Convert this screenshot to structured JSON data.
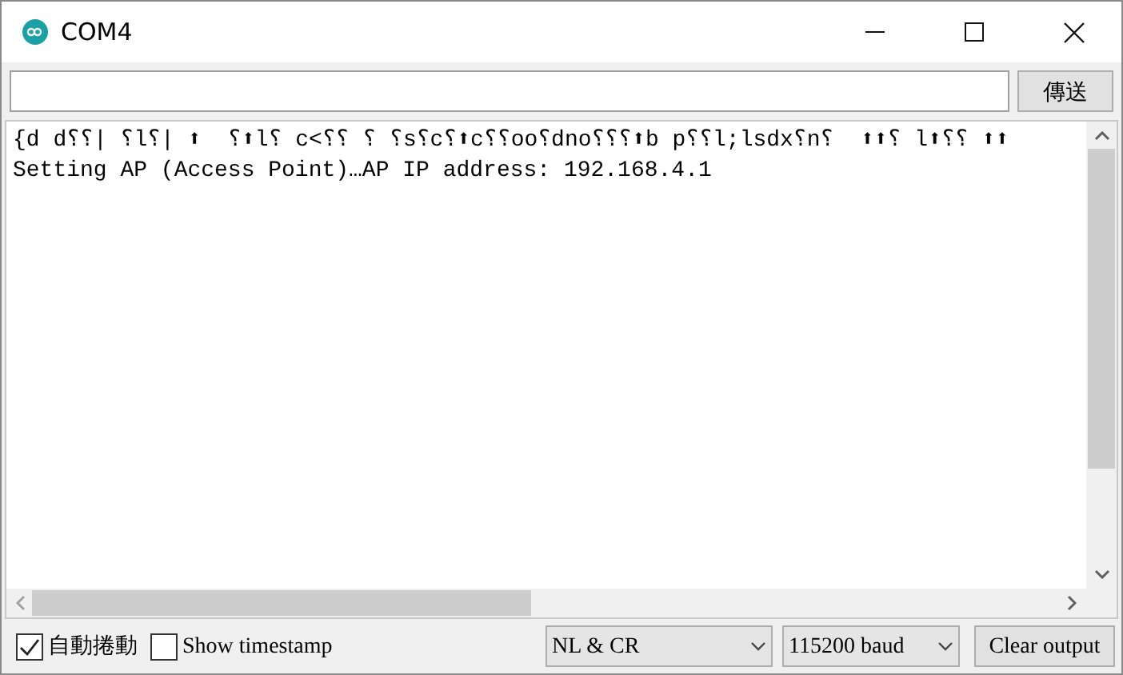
{
  "window": {
    "title": "COM4"
  },
  "send_bar": {
    "send_button": "傳送"
  },
  "output": {
    "lines": [
      "{d d⸮⸮| ⸮l⸮| ⬆  ⸮⬆l⸮ c<⸮⸮ ⸮ ⸮s⸮c⸮⬆c⸮⸮oo⸮dno⸮⸮⸮⬆b p⸮⸮l;lsdx⸮n⸮  ⬆⬆⸮ l⬆⸮⸮ ⬆⬆",
      "Setting AP (Access Point)…AP IP address: 192.168.4.1"
    ]
  },
  "footer": {
    "autoscroll": {
      "label": "自動捲動",
      "checked": true
    },
    "timestamp": {
      "label": "Show timestamp",
      "checked": false
    },
    "line_ending": "NL & CR",
    "baud": "115200 baud",
    "clear_button": "Clear output"
  }
}
